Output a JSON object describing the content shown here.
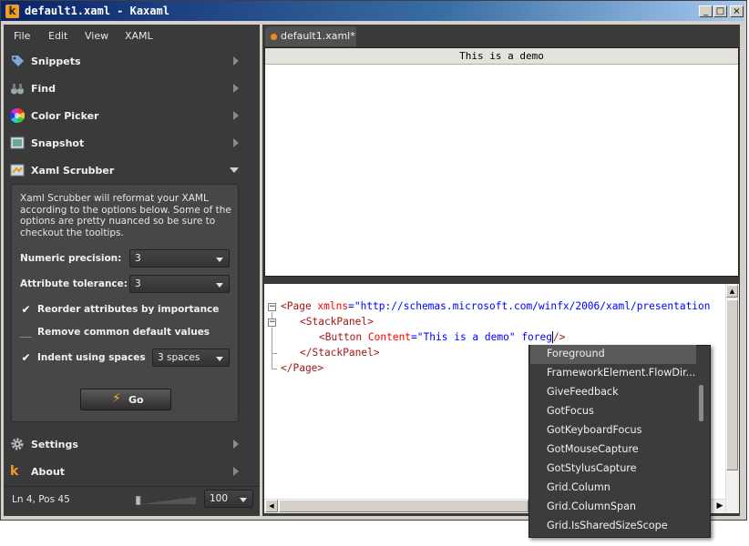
{
  "window": {
    "title": "default1.xaml - Kaxaml",
    "logo": "k"
  },
  "window_buttons": {
    "minimize": "_",
    "maximize": "□",
    "close": "×"
  },
  "menu": [
    "File",
    "Edit",
    "View",
    "XAML"
  ],
  "plugins": [
    {
      "label": "Snippets",
      "icon": "tag-icon"
    },
    {
      "label": "Find",
      "icon": "binoculars-icon"
    },
    {
      "label": "Color Picker",
      "icon": "color-wheel-icon"
    },
    {
      "label": "Snapshot",
      "icon": "picture-icon"
    },
    {
      "label": "Xaml Scrubber",
      "icon": "scrubber-icon"
    }
  ],
  "scrubber": {
    "description": "Xaml Scrubber will reformat your XAML according to the options below. Some of the options are pretty nuanced so be sure to checkout the tooltips.",
    "numeric_precision_label": "Numeric precision:",
    "numeric_precision_value": "3",
    "attribute_tolerance_label": "Attribute tolerance:",
    "attribute_tolerance_value": "3",
    "reorder_label": "Reorder attributes by importance",
    "reorder_checked": true,
    "remove_defaults_label": "Remove common default values",
    "remove_defaults_checked": false,
    "indent_label": "Indent using spaces",
    "indent_checked": true,
    "indent_value": "3 spaces",
    "go_label": "Go"
  },
  "bottom_plugins": [
    {
      "label": "Settings",
      "icon": "gear-icon"
    },
    {
      "label": "About",
      "icon": "kaxaml-logo-icon"
    }
  ],
  "status": {
    "position": "Ln 4, Pos 45",
    "zoom": "100"
  },
  "tab": {
    "label": "default1.xaml*"
  },
  "preview": {
    "button_text": "This is a demo"
  },
  "code": {
    "l1_open": "<Page ",
    "l1_attr": "xmlns",
    "l1_eq": "=",
    "l1_val": "\"http://schemas.microsoft.com/winfx/2006/xaml/presentation",
    "l2": "<StackPanel>",
    "l3_open": "<Button ",
    "l3_attr": "Content",
    "l3_eq": "=",
    "l3_val": "\"This is a demo\"",
    "l3_typed": " foreg",
    "l3_close": "/>",
    "l4": "</StackPanel>",
    "l5": "</Page>"
  },
  "intellisense": [
    "Foreground",
    "FrameworkElement.FlowDir...",
    "GiveFeedback",
    "GotFocus",
    "GotKeyboardFocus",
    "GotMouseCapture",
    "GotStylusCapture",
    "Grid.Column",
    "Grid.ColumnSpan",
    "Grid.IsSharedSizeScope"
  ],
  "colors": {
    "accent": "#f0a020",
    "panel": "#3a3a3a",
    "titlebar": "#0a246a"
  }
}
